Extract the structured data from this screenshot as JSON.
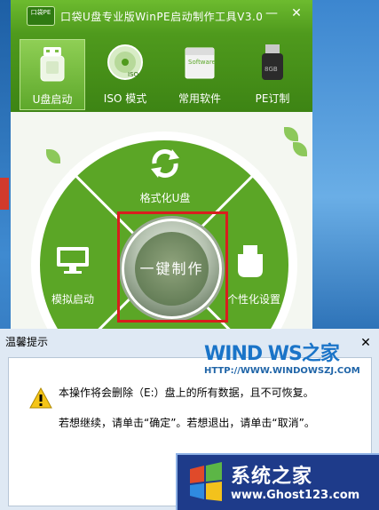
{
  "window": {
    "logo_text": "口袋PE",
    "title": "口袋U盘专业版WinPE启动制作工具V3.0",
    "minimize": "—",
    "close": "✕"
  },
  "tabs": [
    {
      "label": "U盘启动",
      "icon": "usb-drive-icon",
      "active": true
    },
    {
      "label": "ISO 模式",
      "icon": "disc-icon",
      "active": false
    },
    {
      "label": "常用软件",
      "icon": "software-box-icon",
      "active": false
    },
    {
      "label": "PE订制",
      "icon": "usb-stick-icon",
      "active": false
    }
  ],
  "software_box_text": "Software",
  "usb_stick_text": "8GB",
  "disc_text": "ISO",
  "wheel": {
    "format_label": "格式化U盘",
    "simulate_label": "模拟启动",
    "personalize_label": "个性化设置",
    "center_label": "一键制作"
  },
  "dialog": {
    "title": "温馨提示",
    "close": "✕",
    "line1": "本操作将会删除（E:）盘上的所有数据，且不可恢复。",
    "line2": "若想继续，请单击“确定”。若想退出，请单击“取消”。"
  },
  "watermark1": {
    "brand": "WIND WS之家",
    "url": "HTTP://WWW.WINDOWSZJ.COM"
  },
  "watermark2": {
    "title": "系统之家",
    "url": "www.Ghost123.com"
  },
  "colors": {
    "accent_green": "#5aa626",
    "highlight_red": "#d81e1e"
  }
}
